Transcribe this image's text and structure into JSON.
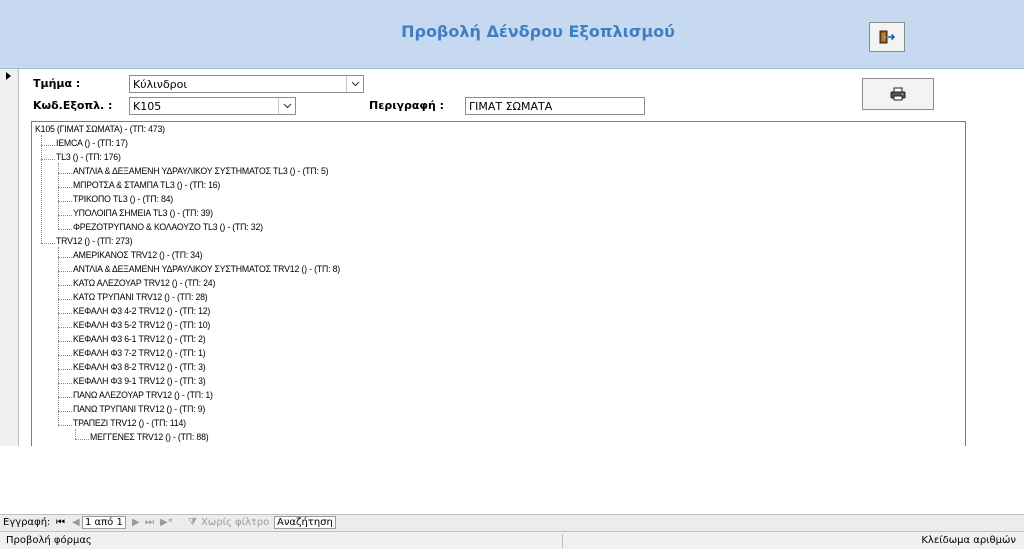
{
  "form": {
    "title": "Προβολή Δένδρου Εξοπλισμού"
  },
  "fields": {
    "tmima": {
      "label": "Τμήμα :",
      "value": "Κύλινδροι"
    },
    "kod": {
      "label": "Κωδ.Εξοπλ. :",
      "value": "K105"
    },
    "perigrafi": {
      "label": "Περιγραφή :",
      "value": "ΓΙΜΑΤ ΣΩΜΑΤΑ"
    }
  },
  "icons": {
    "exit": "exit-door-icon",
    "print": "printer-icon",
    "record": "record-selector-arrow-icon"
  },
  "tree": [
    {
      "level": 0,
      "label": "K105 (ΓΙΜΑΤ ΣΩΜΑΤΑ) - (ΤΠ: 473)"
    },
    {
      "level": 1,
      "label": "IEMCA () - (ΤΠ: 17)"
    },
    {
      "level": 1,
      "label": "TL3 () - (ΤΠ: 176)"
    },
    {
      "level": 2,
      "label": "ΑΝΤΛΙΑ & ΔΕΞΑΜΕΝΗ ΥΔΡΑΥΛΙΚΟΥ ΣΥΣΤΗΜΑΤΟΣ TL3 () - (ΤΠ: 5)"
    },
    {
      "level": 2,
      "label": "ΜΠΡΟΤΣΑ & ΣΤΑΜΠΑ TL3 () - (ΤΠ: 16)"
    },
    {
      "level": 2,
      "label": "ΤΡΙΚΟΠΟ TL3 () - (ΤΠ: 84)"
    },
    {
      "level": 2,
      "label": "ΥΠΟΛΟΙΠΑ ΣΗΜΕΙΑ TL3 () - (ΤΠ: 39)"
    },
    {
      "level": 2,
      "label": "ΦΡΕΖΟΤΡΥΠΑΝΟ & ΚΟΛΑΟΥΖΟ TL3 () - (ΤΠ: 32)"
    },
    {
      "level": 1,
      "label": "TRV12 () - (ΤΠ: 273)"
    },
    {
      "level": 2,
      "label": "ΑΜΕΡΙΚΑΝΟΣ TRV12 () - (ΤΠ: 34)"
    },
    {
      "level": 2,
      "label": "ΑΝΤΛΙΑ & ΔΕΞΑΜΕΝΗ ΥΔΡΑΥΛΙΚΟΥ ΣΥΣΤΗΜΑΤΟΣ TRV12 () - (ΤΠ: 8)"
    },
    {
      "level": 2,
      "label": "ΚΑΤΩ ΑΛΕΖΟΥΑΡ TRV12 () - (ΤΠ: 24)"
    },
    {
      "level": 2,
      "label": "ΚΑΤΩ ΤΡΥΠΑΝΙ TRV12 () - (ΤΠ: 28)"
    },
    {
      "level": 2,
      "label": "ΚΕΦΑΛΗ Φ3 4-2 TRV12 () - (ΤΠ: 12)"
    },
    {
      "level": 2,
      "label": "ΚΕΦΑΛΗ Φ3 5-2 TRV12 () - (ΤΠ: 10)"
    },
    {
      "level": 2,
      "label": "ΚΕΦΑΛΗ Φ3 6-1 TRV12 () - (ΤΠ: 2)"
    },
    {
      "level": 2,
      "label": "ΚΕΦΑΛΗ Φ3 7-2 TRV12 () - (ΤΠ: 1)"
    },
    {
      "level": 2,
      "label": "ΚΕΦΑΛΗ Φ3 8-2 TRV12 () - (ΤΠ: 3)"
    },
    {
      "level": 2,
      "label": "ΚΕΦΑΛΗ Φ3 9-1 TRV12 () - (ΤΠ: 3)"
    },
    {
      "level": 2,
      "label": "ΠΑΝΩ ΑΛΕΖΟΥΑΡ TRV12 () - (ΤΠ: 1)"
    },
    {
      "level": 2,
      "label": "ΠΑΝΩ ΤΡΥΠΑΝΙ TRV12 () - (ΤΠ: 9)"
    },
    {
      "level": 2,
      "label": "ΤΡΑΠΕΖΙ TRV12 () - (ΤΠ: 114)"
    },
    {
      "level": 3,
      "label": "ΜΕΓΓΕΝΕΣ TRV12 () - (ΤΠ: 88)"
    }
  ],
  "navigation": {
    "record_label": "Εγγραφή:",
    "first": "⏮",
    "prev": "◀",
    "position": "1 από 1",
    "next": "▶",
    "last": "⏭",
    "new": "▶*",
    "filter": "Χωρίς φίλτρο",
    "search": "Αναζήτηση"
  },
  "status": {
    "left": "Προβολή φόρμας",
    "right": "Κλείδωμα αριθμών"
  }
}
